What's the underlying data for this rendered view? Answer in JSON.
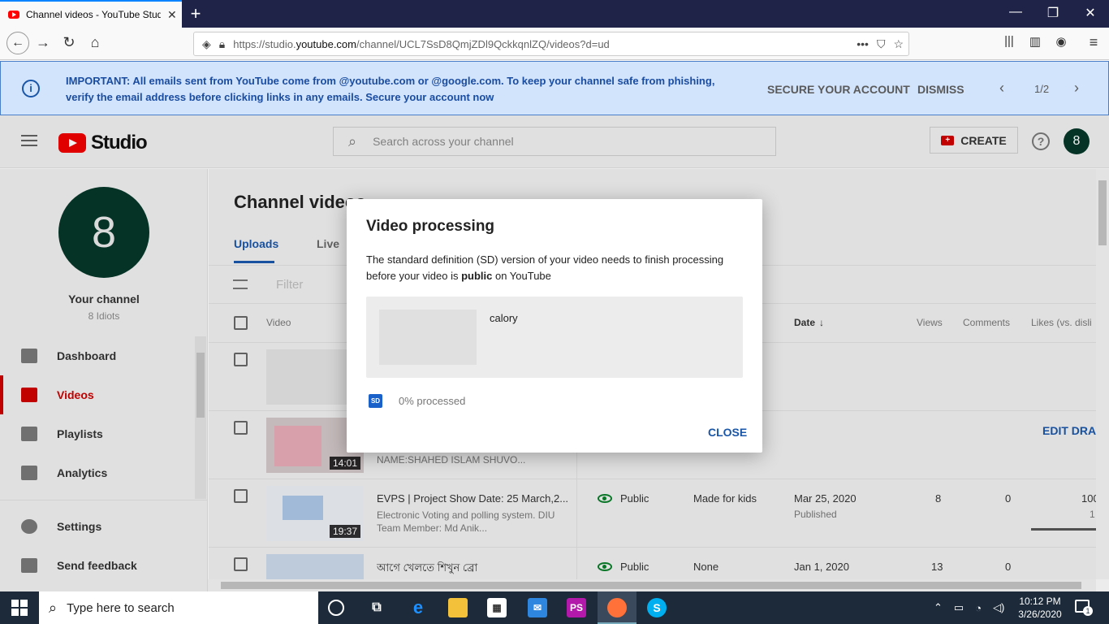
{
  "browser": {
    "tab_title": "Channel videos - YouTube Studio",
    "url_prefix": "https://studio.",
    "url_domain": "youtube.com",
    "url_path": "/channel/UCL7SsD8QmjZDl9QckkqnlZQ/videos?d=ud"
  },
  "banner": {
    "message": "IMPORTANT: All emails sent from YouTube come from @youtube.com or @google.com. To keep your channel safe from phishing, verify the email address before clicking links in any emails. Secure your account now",
    "secure_label": "SECURE YOUR ACCOUNT",
    "dismiss_label": "DISMISS",
    "pager": "1/2"
  },
  "header": {
    "logo_text": "Studio",
    "search_placeholder": "Search across your channel",
    "create_label": "CREATE",
    "avatar_letter": "8"
  },
  "sidebar": {
    "avatar_letter": "8",
    "channel_title": "Your channel",
    "channel_name": "8 Idiots",
    "items": [
      {
        "label": "Dashboard",
        "icon": "dashboard-icon"
      },
      {
        "label": "Videos",
        "icon": "videos-icon"
      },
      {
        "label": "Playlists",
        "icon": "playlists-icon"
      },
      {
        "label": "Analytics",
        "icon": "analytics-icon"
      },
      {
        "label": "Settings",
        "icon": "gear-icon"
      },
      {
        "label": "Send feedback",
        "icon": "feedback-icon"
      }
    ]
  },
  "main": {
    "title": "Channel videos",
    "tabs": [
      "Uploads",
      "Live"
    ],
    "filter_placeholder": "Filter",
    "columns": {
      "video": "Video",
      "date": "Date",
      "views": "Views",
      "comments": "Comments",
      "likes": "Likes (vs. disli"
    },
    "rows": [
      {
        "title": "",
        "desc": "",
        "duration": ""
      },
      {
        "title": "",
        "desc": "NAME:SHAHED ISLAM SHUVO...",
        "duration": "14:01",
        "action": "EDIT DRAF"
      },
      {
        "title": "EVPS | Project Show Date: 25 March,2...",
        "desc": "Electronic Voting and polling system. DIU Team Member: Md Anik...",
        "duration": "19:37",
        "visibility": "Public",
        "restrictions": "Made for kids",
        "date": "Mar 25, 2020",
        "date_sub": "Published",
        "views": "8",
        "comments": "0",
        "likes": "100",
        "likes_sub": "1"
      },
      {
        "title": "আগে খেলতে শিখুন ব্রো",
        "desc": "",
        "duration": "",
        "visibility": "Public",
        "restrictions": "None",
        "date": "Jan 1, 2020",
        "views": "13",
        "comments": "0"
      }
    ]
  },
  "dialog": {
    "title": "Video processing",
    "text_before": "The standard definition (SD) version of your video needs to finish processing before your video is ",
    "text_bold": "public",
    "text_after": " on YouTube",
    "video_name": "calory",
    "badge": "SD",
    "progress_text": "0% processed",
    "progress_value": 0,
    "close_label": "CLOSE"
  },
  "taskbar": {
    "search_placeholder": "Type here to search",
    "time": "10:12 PM",
    "date": "3/26/2020",
    "notification_count": "1"
  }
}
